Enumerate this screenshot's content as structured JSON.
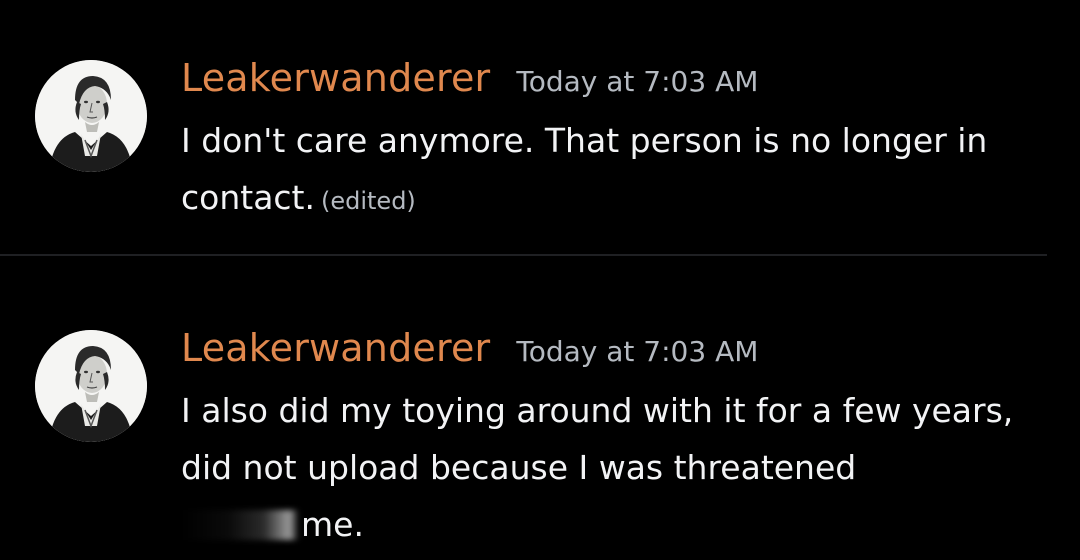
{
  "messages": [
    {
      "username": "Leakerwanderer",
      "timestamp": "Today at 7:03 AM",
      "lines": [
        "I don't care anymore. That person is no longer in",
        "contact."
      ],
      "edited_label": "(edited)"
    },
    {
      "username": "Leakerwanderer",
      "timestamp": "Today at 7:03 AM",
      "lines": [
        "I also did my toying around with it for a few years,",
        "did not upload because I was threatened",
        "me."
      ]
    }
  ],
  "avatar_icon": "engraved-portrait-icon",
  "colors": {
    "background": "#000000",
    "username": "#e0884e",
    "timestamp": "#b5bac1",
    "text": "#f2f3f5"
  }
}
